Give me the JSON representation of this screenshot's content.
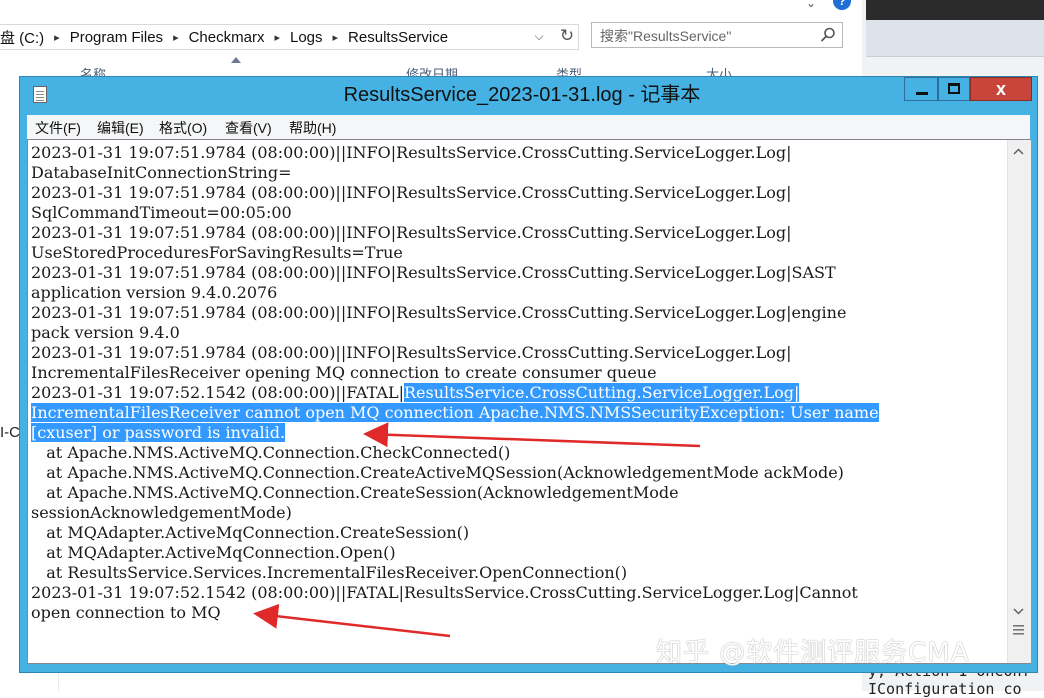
{
  "explorer": {
    "breadcrumb": [
      "盘 (C:)",
      "Program Files",
      "Checkmarx",
      "Logs",
      "ResultsService"
    ],
    "breadcrumb_separator": "▸",
    "search_placeholder": "搜索\"ResultsService\"",
    "columns": [
      "名称",
      "修改日期",
      "类型",
      "大小"
    ],
    "left_pane_fragment": "I-C"
  },
  "background_right_text": [
    "y, Action`1 onConf",
    "IConfiguration co"
  ],
  "notepad": {
    "title": "ResultsService_2023-01-31.log - 记事本",
    "close_glyph": "x",
    "menu": [
      "文件(F)",
      "编辑(E)",
      "格式(O)",
      "查看(V)",
      "帮助(H)"
    ],
    "lines": [
      {
        "text": "2023-01-31 19:07:51.9784 (08:00:00)||INFO|ResultsService.CrossCutting.ServiceLogger.Log|",
        "selected": false
      },
      {
        "text": "DatabaseInitConnectionString=",
        "selected": false
      },
      {
        "text": "2023-01-31 19:07:51.9784 (08:00:00)||INFO|ResultsService.CrossCutting.ServiceLogger.Log|",
        "selected": false
      },
      {
        "text": "SqlCommandTimeout=00:05:00",
        "selected": false
      },
      {
        "text": "2023-01-31 19:07:51.9784 (08:00:00)||INFO|ResultsService.CrossCutting.ServiceLogger.Log|",
        "selected": false
      },
      {
        "text": "UseStoredProceduresForSavingResults=True",
        "selected": false
      },
      {
        "text": "2023-01-31 19:07:51.9784 (08:00:00)||INFO|ResultsService.CrossCutting.ServiceLogger.Log|SAST",
        "selected": false
      },
      {
        "text": "application version 9.4.0.2076",
        "selected": false
      },
      {
        "text": "2023-01-31 19:07:51.9784 (08:00:00)||INFO|ResultsService.CrossCutting.ServiceLogger.Log|engine",
        "selected": false
      },
      {
        "text": "pack version 9.4.0",
        "selected": false
      },
      {
        "text": "2023-01-31 19:07:51.9784 (08:00:00)||INFO|ResultsService.CrossCutting.ServiceLogger.Log|",
        "selected": false
      },
      {
        "text": "IncrementalFilesReceiver opening MQ connection to create consumer queue",
        "selected": false
      },
      {
        "text": "2023-01-31 19:07:52.1542 (08:00:00)||FATAL|",
        "selected_tail": "ResultsService.CrossCutting.ServiceLogger.Log|",
        "selected": "partial"
      },
      {
        "text": "IncrementalFilesReceiver cannot open MQ connection Apache.NMS.NMSSecurityException: User name",
        "selected": true
      },
      {
        "text": "[cxuser] or password is invalid.",
        "selected": true
      },
      {
        "text": "   at Apache.NMS.ActiveMQ.Connection.CheckConnected()",
        "selected": false
      },
      {
        "text": "   at Apache.NMS.ActiveMQ.Connection.CreateActiveMQSession(AcknowledgementMode ackMode)",
        "selected": false
      },
      {
        "text": "   at Apache.NMS.ActiveMQ.Connection.CreateSession(AcknowledgementMode",
        "selected": false
      },
      {
        "text": "sessionAcknowledgementMode)",
        "selected": false
      },
      {
        "text": "   at MQAdapter.ActiveMqConnection.CreateSession()",
        "selected": false
      },
      {
        "text": "   at MQAdapter.ActiveMqConnection.Open()",
        "selected": false
      },
      {
        "text": "   at ResultsService.Services.IncrementalFilesReceiver.OpenConnection()",
        "selected": false
      },
      {
        "text": "2023-01-31 19:07:52.1542 (08:00:00)||FATAL|ResultsService.CrossCutting.ServiceLogger.Log|Cannot",
        "selected": false
      },
      {
        "text": "open connection to MQ",
        "selected": false
      }
    ]
  },
  "watermark": "知乎 @软件测评服务CMA",
  "colors": {
    "notepad_frame": "#46b2e3",
    "close_button": "#c7453a",
    "selection": "#3399ff",
    "annotation_arrow": "#e02a2a"
  },
  "icons": [
    "help-icon",
    "refresh-icon",
    "search-icon",
    "notepad-app-icon",
    "minimize-icon",
    "maximize-icon",
    "close-icon",
    "scroll-up-icon",
    "scroll-down-icon",
    "resize-grip-icon"
  ]
}
